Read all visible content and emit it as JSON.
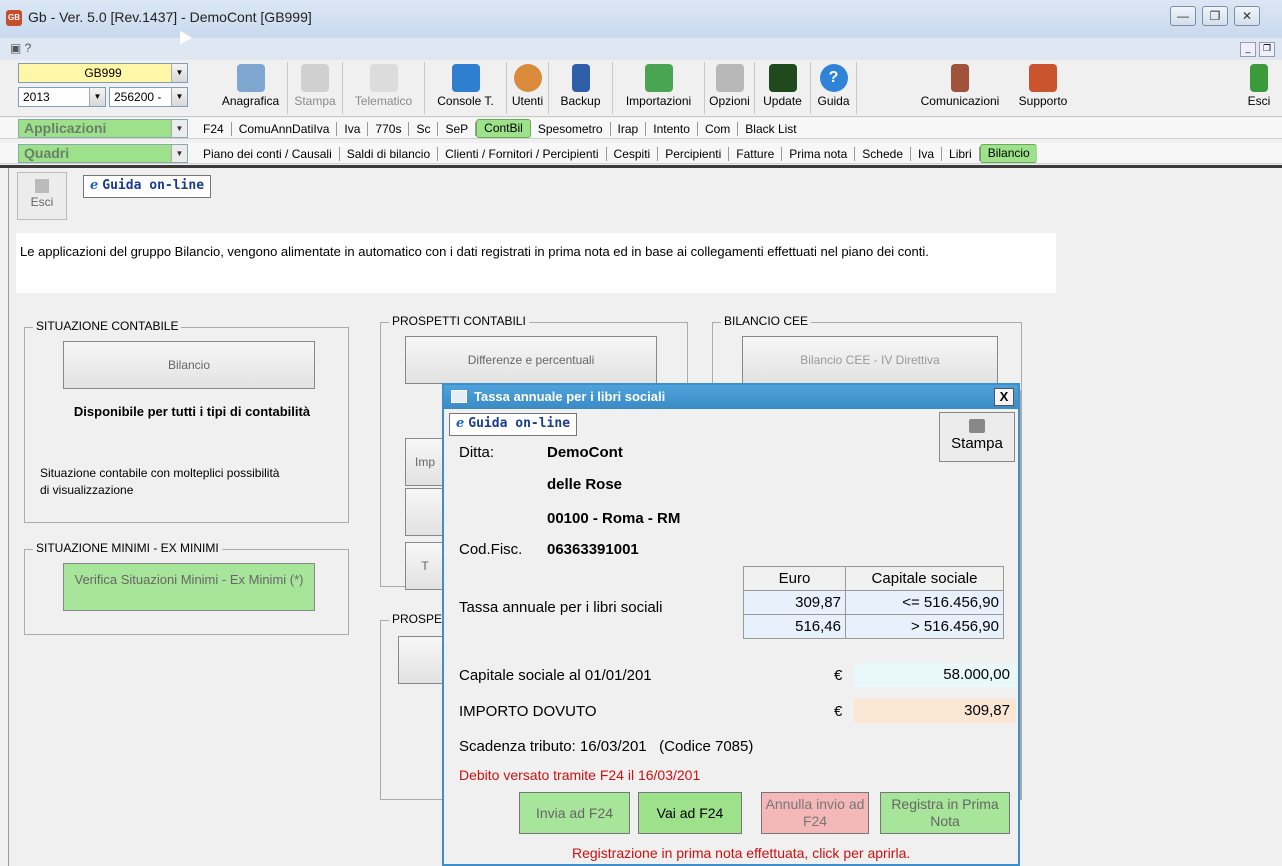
{
  "window": {
    "title": "Gb - Ver. 5.0 [Rev.1437] - DemoCont [GB999]",
    "app_icon": "GB",
    "controls": [
      "minimize-icon",
      "restore-icon",
      "close-icon"
    ]
  },
  "toolbar": {
    "company_code": "GB999",
    "year": "2013",
    "code": "256200 -",
    "buttons": [
      {
        "label": "Anagrafica",
        "icon": "address-book-icon",
        "enabled": true
      },
      {
        "label": "Stampa",
        "icon": "printer-icon",
        "enabled": false
      },
      {
        "label": "Telematico",
        "icon": "telematic-icon",
        "enabled": false
      },
      {
        "label": "Console T.",
        "icon": "console-icon",
        "enabled": true
      },
      {
        "label": "Utenti",
        "icon": "users-icon",
        "enabled": true
      },
      {
        "label": "Backup",
        "icon": "backup-icon",
        "enabled": true
      },
      {
        "label": "Importazioni",
        "icon": "import-icon",
        "enabled": true
      },
      {
        "label": "Opzioni",
        "icon": "options-icon",
        "enabled": true
      },
      {
        "label": "Update",
        "icon": "update-icon",
        "enabled": true
      },
      {
        "label": "Guida",
        "icon": "help-icon",
        "enabled": true
      },
      {
        "label": "Comunicazioni",
        "icon": "communications-icon",
        "enabled": true
      },
      {
        "label": "Supporto",
        "icon": "support-icon",
        "enabled": true
      }
    ],
    "exit_label": "Esci"
  },
  "menu_applicazioni": {
    "combo_label": "Applicazioni",
    "items": [
      "F24",
      "ComuAnnDatiIva",
      "Iva",
      "770s",
      "Sc",
      "SeP",
      "ContBil",
      "Spesometro",
      "Irap",
      "Intento",
      "Com",
      "Black List"
    ],
    "active": "ContBil"
  },
  "menu_quadri": {
    "combo_label": "Quadri",
    "items": [
      "Piano dei conti / Causali",
      "Saldi di bilancio",
      "Clienti / Fornitori / Percipienti",
      "Cespiti",
      "Percipienti",
      "Fatture",
      "Prima nota",
      "Schede",
      "Iva",
      "Libri",
      "Bilancio"
    ],
    "active": "Bilancio"
  },
  "main": {
    "esci_label": "Esci",
    "guida_label": "Guida on-line",
    "description": "Le applicazioni del gruppo Bilancio, vengono alimentate in automatico con i dati registrati in prima nota ed in base ai collegamenti effettuati nel piano dei conti.",
    "situazione_contabile": {
      "legend": "SITUAZIONE CONTABILE",
      "button": "Bilancio",
      "availability": "Disponibile per tutti i tipi di contabilità",
      "info": "Situazione contabile con molteplici possibilità di visualizzazione"
    },
    "situazione_minimi": {
      "legend": "SITUAZIONE MINIMI - EX MINIMI",
      "button": "Verifica Situazioni Minimi - Ex Minimi (*)"
    },
    "prospetti_contabili": {
      "legend": "PROSPETTI CONTABILI",
      "button1": "Differenze e percentuali",
      "partial_labels": [
        "Imp",
        "T"
      ]
    },
    "prospetti2_legend": "PROSPE",
    "bilancio_cee": {
      "legend": "BILANCIO CEE",
      "button": "Bilancio CEE - IV Direttiva"
    }
  },
  "dialog": {
    "title": "Tassa annuale per i libri sociali",
    "guida_label": "Guida on-line",
    "stampa_label": "Stampa",
    "ditta_label": "Ditta:",
    "ditta_name": "DemoCont",
    "ditta_name2": "delle Rose",
    "ditta_address": "00100 - Roma - RM",
    "codfisc_label": "Cod.Fisc.",
    "codfisc_value": "06363391001",
    "table_label": "Tassa annuale per i libri sociali",
    "table_headers": [
      "Euro",
      "Capitale sociale"
    ],
    "table_rows": [
      [
        "309,87",
        "<= 516.456,90"
      ],
      [
        "516,46",
        "> 516.456,90"
      ]
    ],
    "capitale_label": "Capitale sociale al 01/01/201",
    "capitale_currency": "€",
    "capitale_value": "58.000,00",
    "importo_label": "IMPORTO DOVUTO",
    "importo_currency": "€",
    "importo_value": "309,87",
    "scadenza": "Scadenza tributo: 16/03/201   (Codice 7085)",
    "debito": "Debito versato tramite F24 il 16/03/201",
    "btn_invia": "Invia ad F24",
    "btn_vai": "Vai ad F24",
    "btn_annulla": "Annulla invio ad F24",
    "btn_registra": "Registra in Prima Nota",
    "footer_note": "Registrazione in prima nota effettuata, click per aprirla."
  },
  "colors": {
    "green_menu": "#9de28b",
    "dialog_title": "#3a8bc6",
    "red_text": "#d01010",
    "capitale_bg": "#e8f8fb",
    "importo_bg": "#fbe6d3"
  }
}
